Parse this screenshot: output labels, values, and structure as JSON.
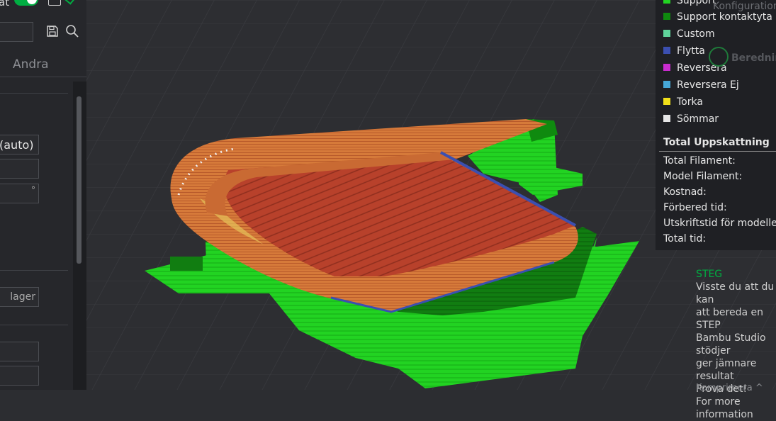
{
  "left_panel": {
    "partial_label": "at",
    "tab_label": "Andra",
    "auto_field": "(auto)",
    "degree_symbol": "°",
    "layer_field": "lager"
  },
  "legend": {
    "items": [
      {
        "label": "Support",
        "color": "#22d322"
      },
      {
        "label": "Support kontaktyta",
        "color": "#0f8a0f"
      },
      {
        "label": "Custom",
        "color": "#5fd39a"
      },
      {
        "label": "Flytta",
        "color": "#3b4fb0"
      },
      {
        "label": "Reversera",
        "color": "#c92ccf"
      },
      {
        "label": "Reversera Ej",
        "color": "#46a8d8"
      },
      {
        "label": "Torka",
        "color": "#f2e01a"
      },
      {
        "label": "Sömmar",
        "color": "#e6e6e6"
      }
    ],
    "estimate_title": "Total Uppskattning",
    "estimate_rows": [
      "Total Filament:",
      "Model Filament:",
      "Kostnad:",
      "Förbered tid:",
      "Utskriftstid för modellen:",
      "Total tid:"
    ]
  },
  "right_panel": {
    "config_partial": "Konfigurationen",
    "slice_partial": "Beredning"
  },
  "tips": {
    "title": "STEG",
    "lines": [
      "Visste du att du kan",
      "att bereda en STEP",
      "Bambu Studio stödjer",
      "ger jämnare resultat",
      "Prova det!",
      "For more information"
    ],
    "collapse_label": "Komprimera"
  },
  "colors": {
    "support": "#22d322",
    "support_interface": "#0f8a0f",
    "wall": "#d67a3a",
    "infill": "#b8412b",
    "travel": "#3b4fb0",
    "accent_green": "#00ae42"
  }
}
